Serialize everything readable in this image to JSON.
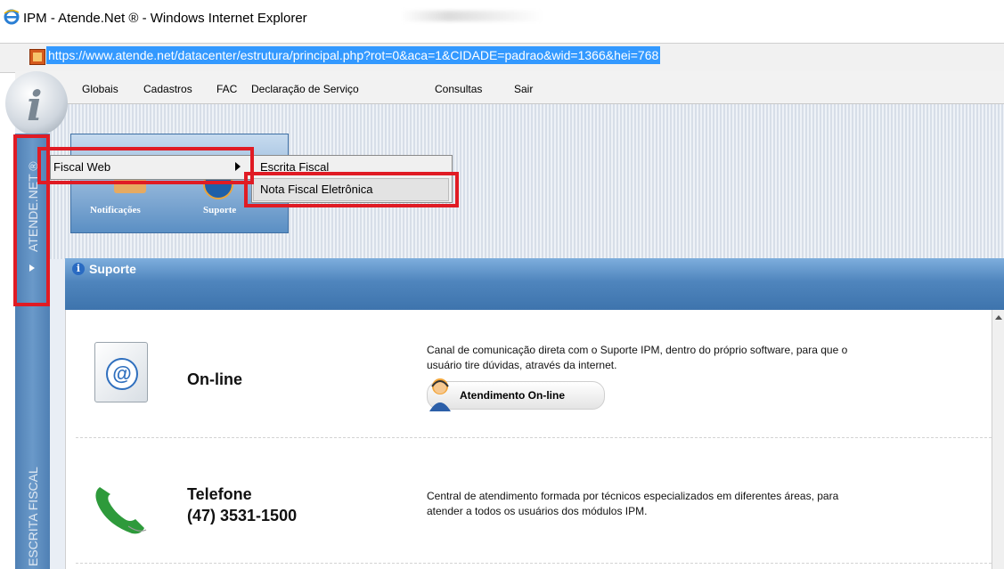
{
  "window": {
    "title": "IPM - Atende.Net ® - Windows Internet Explorer",
    "url": "https://www.atende.net/datacenter/estrutura/principal.php?rot=0&aca=1&CIDADE=padrao&wid=1366&hei=768"
  },
  "menu": [
    "Globais",
    "Cadastros",
    "FAC",
    "Declaração de Serviço",
    "Consultas",
    "Sair"
  ],
  "sidebar": {
    "top_label": "ATENDE.NET ®",
    "bottom_label": "ESCRITA FISCAL"
  },
  "tiles": {
    "notificacoes": "Notificações",
    "suporte": "Suporte"
  },
  "dropdown": {
    "parent": "Fiscal Web",
    "items": [
      "Escrita Fiscal",
      "Nota Fiscal Eletrônica"
    ]
  },
  "panel": {
    "title": "Suporte",
    "online": {
      "title": "On-line",
      "description_line1": "Canal de comunicação direta com o Suporte IPM, dentro do próprio software, para que o",
      "description_line2": "usuário tire dúvidas, através da internet.",
      "button": "Atendimento On-line"
    },
    "telefone": {
      "title": "Telefone",
      "number": "(47) 3531-1500",
      "description_line1": "Central de atendimento formada por técnicos especializados em diferentes áreas, para",
      "description_line2": "atender a todos os usuários dos módulos IPM."
    }
  },
  "colors": {
    "highlight_red": "#e01b24",
    "panel_blue": "#4f85bd",
    "url_selection": "#3399ff"
  }
}
